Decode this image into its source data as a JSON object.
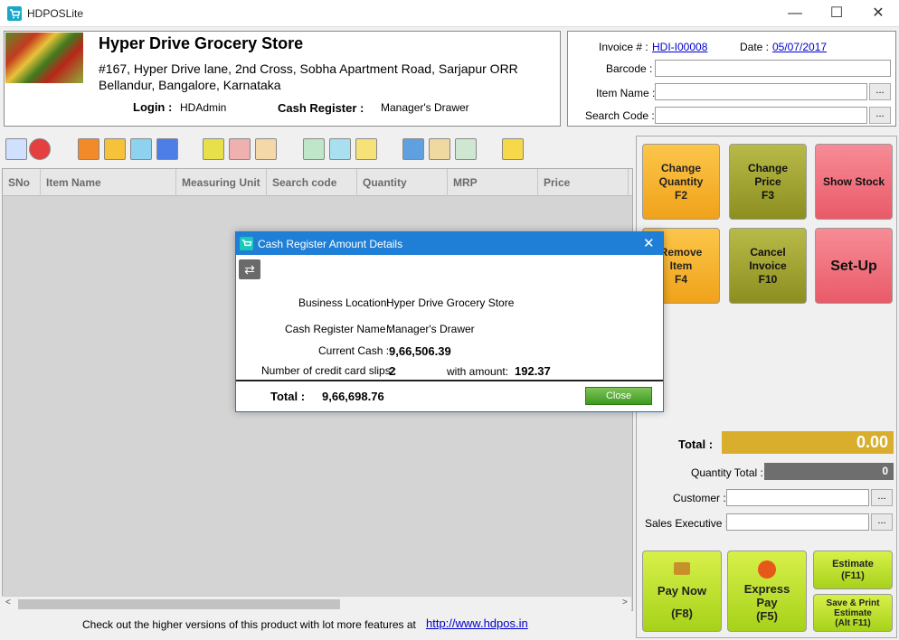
{
  "window": {
    "title": "HDPOSLite",
    "minimize": "—",
    "maximize": "☐",
    "close": "✕"
  },
  "store": {
    "name": "Hyper Drive Grocery Store",
    "address_line1": "#167, Hyper Drive lane, 2nd Cross, Sobha Apartment Road, Sarjapur ORR",
    "address_line2": "Bellandur, Bangalore, Karnataka",
    "login_label": "Login :",
    "login_value": "HDAdmin",
    "register_label": "Cash Register  :",
    "register_value": "Manager's Drawer"
  },
  "invoice": {
    "invoice_label": "Invoice # :",
    "invoice_value": "HDI-I00008",
    "date_label": "Date :",
    "date_value": "05/07/2017",
    "barcode_label": "Barcode :",
    "item_name_label": "Item Name :",
    "search_code_label": "Search Code :",
    "dots": "..."
  },
  "toolbar_icons": [
    "register-icon",
    "discount-icon",
    "edit-icon",
    "cart-icon",
    "delivery-icon",
    "transfer-icon",
    "customers-icon",
    "user-icon",
    "chart-icon",
    "purchase-icon",
    "stock-icon",
    "flow-icon",
    "report-icon",
    "cash-icon",
    "document-icon",
    "profile-icon"
  ],
  "grid": {
    "columns": [
      "SNo",
      "Item Name",
      "Measuring Unit",
      "Search code",
      "Quantity",
      "MRP",
      "Price"
    ]
  },
  "footer": {
    "text": "Check out the higher versions of this product with lot more features at",
    "link": "http://www.hdpos.in"
  },
  "buttons": {
    "change_qty": [
      "Change",
      "Quantity",
      "F2"
    ],
    "change_price": [
      "Change",
      "Price",
      "F3"
    ],
    "show_stock": "Show Stock",
    "remove_item": [
      "Remove",
      "Item",
      "F4"
    ],
    "cancel_invoice": [
      "Cancel",
      "Invoice",
      "F10"
    ],
    "setup": "Set-Up",
    "pay_now": [
      "Pay Now",
      "(F8)"
    ],
    "express_pay": [
      "Express",
      "Pay",
      "(F5)"
    ],
    "estimate": [
      "Estimate",
      "(F11)"
    ],
    "save_print_estimate": [
      "Save & Print",
      "Estimate",
      "(Alt F11)"
    ]
  },
  "totals": {
    "total_label": "Total :",
    "total_value": "0.00",
    "qty_total_label": "Quantity Total :",
    "qty_total_value": "0",
    "customer_label": "Customer :",
    "sales_exec_label": "Sales Executive :"
  },
  "dialog": {
    "title": "Cash Register Amount Details",
    "business_location_label": "Business Location:",
    "business_location_value": "Hyper Drive Grocery Store",
    "register_name_label": "Cash Register Name :",
    "register_name_value": "Manager's Drawer",
    "current_cash_label": "Current Cash :",
    "current_cash_value": "9,66,506.39",
    "cc_slips_label": "Number of credit card slips :",
    "cc_slips_value": "2",
    "with_amount_label": "with amount:",
    "with_amount_value": "192.37",
    "total_label": "Total :",
    "total_value": "9,66,698.76",
    "close_label": "Close"
  },
  "colors": {
    "accent_blue": "#1f7fd6",
    "total_bg": "#d9ae2c",
    "qty_bg": "#6e6e6e"
  }
}
